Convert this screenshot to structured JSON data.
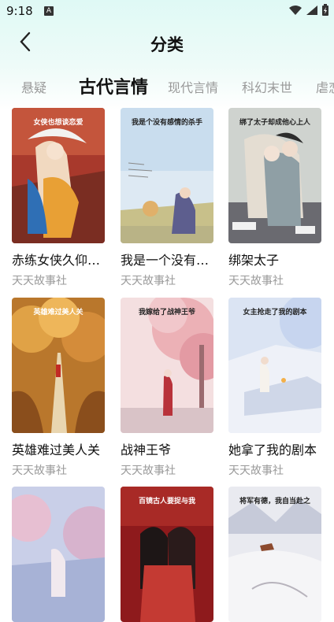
{
  "status_bar": {
    "time": "9:18",
    "app_badge": "A"
  },
  "header": {
    "title": "分类"
  },
  "tabs": [
    {
      "label": "悬疑",
      "active": false
    },
    {
      "label": "古代言情",
      "active": true
    },
    {
      "label": "现代言情",
      "active": false
    },
    {
      "label": "科幻末世",
      "active": false
    },
    {
      "label": "虐恋",
      "active": false
    }
  ],
  "books": [
    {
      "title": "赤练女侠久仰大名",
      "publisher": "天天故事社",
      "cover_text": "女侠也想谈恋爱"
    },
    {
      "title": "我是一个没有感情的杀手",
      "publisher": "天天故事社",
      "cover_text": "我是个没有感情的杀手"
    },
    {
      "title": "绑架太子",
      "publisher": "天天故事社",
      "cover_text": "绑了太子却成他心上人"
    },
    {
      "title": "英雄难过美人关",
      "publisher": "天天故事社",
      "cover_text": "英雄难过美人关"
    },
    {
      "title": "战神王爷",
      "publisher": "天天故事社",
      "cover_text": "我嫁给了战神王爷"
    },
    {
      "title": "她拿了我的剧本",
      "publisher": "天天故事社",
      "cover_text": "女主抢走了我的剧本"
    },
    {
      "title": "",
      "publisher": "",
      "cover_text": ""
    },
    {
      "title": "",
      "publisher": "",
      "cover_text": "百镜古人要捉与我"
    },
    {
      "title": "",
      "publisher": "",
      "cover_text": "将军有德，我自当赴之"
    }
  ],
  "colors": {
    "accent_bg": "#dff9f5",
    "title_text": "#111111",
    "muted_text": "#999999"
  }
}
